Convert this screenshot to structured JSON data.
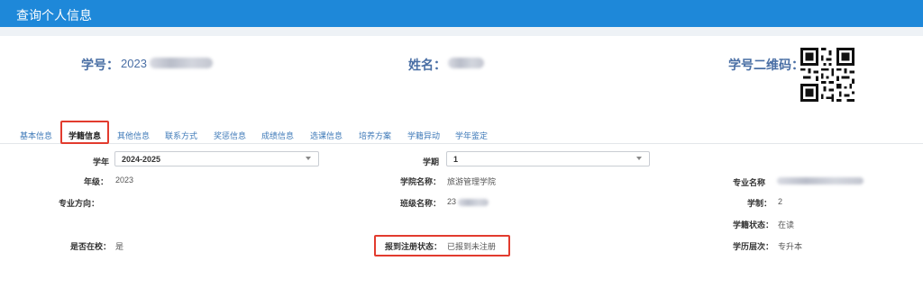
{
  "window": {
    "title": "查询个人信息"
  },
  "header": {
    "student_id_label": "学号：",
    "student_id_value": "2023",
    "name_label": "姓名：",
    "qr_label": "学号二维码："
  },
  "tabs": [
    {
      "label": "基本信息",
      "active": false
    },
    {
      "label": "学籍信息",
      "active": true
    },
    {
      "label": "其他信息",
      "active": false
    },
    {
      "label": "联系方式",
      "active": false
    },
    {
      "label": "奖惩信息",
      "active": false
    },
    {
      "label": "成绩信息",
      "active": false
    },
    {
      "label": "选课信息",
      "active": false
    },
    {
      "label": "培养方案",
      "active": false
    },
    {
      "label": "学籍异动",
      "active": false
    },
    {
      "label": "学年鉴定",
      "active": false
    }
  ],
  "filters": {
    "year_label": "学年",
    "year_value": "2024-2025",
    "term_label": "学期",
    "term_value": "1"
  },
  "fields": {
    "grade_label": "年级：",
    "grade_value": "2023",
    "college_label": "学院名称：",
    "college_value": "旅游管理学院",
    "major_label": "专业名称",
    "direction_label": "专业方向：",
    "class_label": "班级名称：",
    "class_value": "23",
    "duration_label": "学制：",
    "duration_value": "2",
    "status_label": "学籍状态：",
    "status_value": "在读",
    "in_school_label": "是否在校：",
    "in_school_value": "是",
    "registration_label": "报到注册状态：",
    "registration_value": "已报到未注册",
    "level_label": "学历层次：",
    "level_value": "专升本"
  },
  "colors": {
    "titlebar": "#1e88d9",
    "highlight": "#e23b2e",
    "header_text": "#4a6fa5"
  }
}
